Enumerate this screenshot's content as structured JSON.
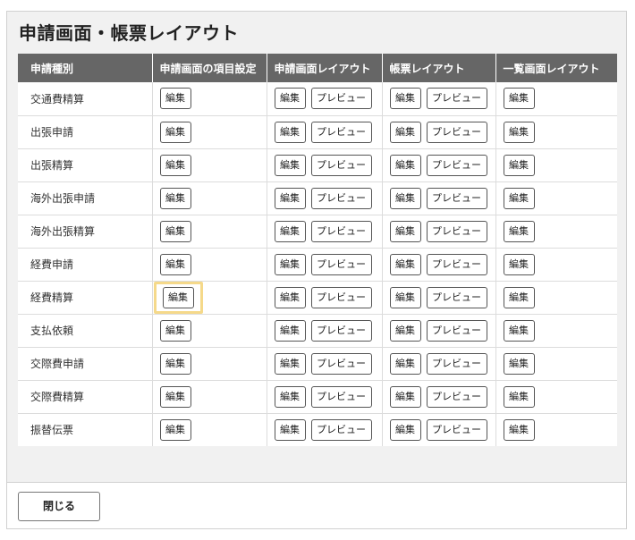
{
  "dialog": {
    "title": "申請画面・帳票レイアウト",
    "close_label": "閉じる"
  },
  "table": {
    "headers": [
      "申請種別",
      "申請画面の項目設定",
      "申請画面レイアウト",
      "帳票レイアウト",
      "一覧画面レイアウト"
    ],
    "edit_label": "編集",
    "preview_label": "プレビュー",
    "rows": [
      {
        "type": "交通費精算"
      },
      {
        "type": "出張申請"
      },
      {
        "type": "出張精算"
      },
      {
        "type": "海外出張申請"
      },
      {
        "type": "海外出張精算"
      },
      {
        "type": "経費申請"
      },
      {
        "type": "経費精算"
      },
      {
        "type": "支払依頼"
      },
      {
        "type": "交際費申請"
      },
      {
        "type": "交際費精算"
      },
      {
        "type": "振替伝票"
      }
    ]
  }
}
